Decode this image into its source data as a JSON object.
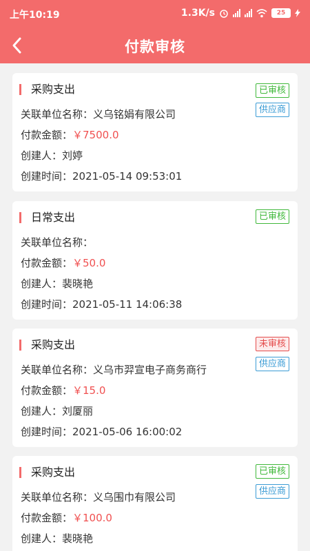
{
  "status_bar": {
    "time": "上午10:19",
    "speed": "1.3K/s",
    "battery": "25"
  },
  "nav": {
    "title": "付款审核"
  },
  "labels": {
    "unit": "关联单位名称：",
    "amount": "付款金额：",
    "creator": "创建人：",
    "created": "创建时间："
  },
  "cards": [
    {
      "type": "采购支出",
      "status": "已审核",
      "supplier_tag": "供应商",
      "unit": "义乌铭娟有限公司",
      "amount": "￥7500.0",
      "creator": "刘婷",
      "created": "2021-05-14 09:53:01"
    },
    {
      "type": "日常支出",
      "status": "已审核",
      "supplier_tag": "",
      "unit": "",
      "amount": "￥50.0",
      "creator": "裴晓艳",
      "created": "2021-05-11 14:06:38"
    },
    {
      "type": "采购支出",
      "status": "未审核",
      "supplier_tag": "供应商",
      "unit": "义乌市羿宣电子商务商行",
      "amount": "￥15.0",
      "creator": "刘厦丽",
      "created": "2021-05-06 16:00:02"
    },
    {
      "type": "采购支出",
      "status": "已审核",
      "supplier_tag": "供应商",
      "unit": "义乌围巾有限公司",
      "amount": "￥100.0",
      "creator": "裴晓艳",
      "created": ""
    }
  ]
}
